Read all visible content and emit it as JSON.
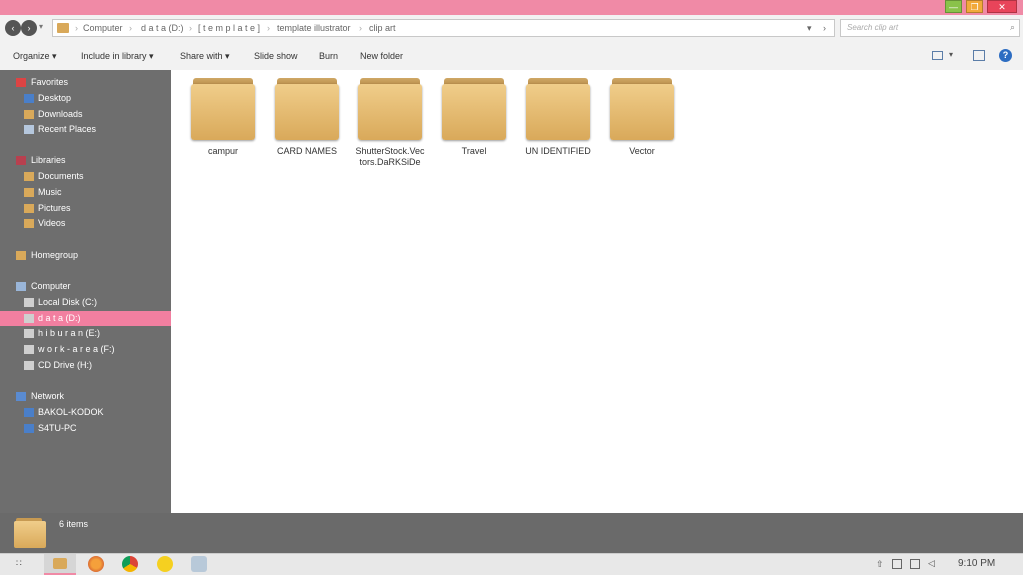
{
  "window": {
    "minimize_label": "—",
    "maximize_label": "❐",
    "close_label": "✕"
  },
  "address": {
    "crumbs": [
      "Computer",
      "d a t a (D:)",
      "[ t e m p l a t e ]",
      "template illustrator",
      "clip art"
    ],
    "dropdown_glyph": "▾",
    "refresh_glyph": "›"
  },
  "search": {
    "placeholder": "Search clip art"
  },
  "toolbar": {
    "organize": "Organize ▾",
    "include_library": "Include in library ▾",
    "share_with": "Share with ▾",
    "slide_show": "Slide show",
    "burn": "Burn",
    "new_folder": "New folder",
    "help_glyph": "?"
  },
  "sidebar": {
    "favorites": "Favorites",
    "desktop": "Desktop",
    "downloads": "Downloads",
    "recent_places": "Recent Places",
    "libraries": "Libraries",
    "documents": "Documents",
    "music": "Music",
    "pictures": "Pictures",
    "videos": "Videos",
    "homegroup": "Homegroup",
    "computer": "Computer",
    "local_disk": "Local Disk (C:)",
    "data_d": "d a t a (D:)",
    "hiburan": "h i b u r a n (E:)",
    "work_area": "w o r k - a r e a (F:)",
    "cd_drive": "CD Drive (H:)",
    "network": "Network",
    "bakol": "BAKOL-KODOK",
    "satu": "S4TU-PC"
  },
  "folders": [
    {
      "name": "campur"
    },
    {
      "name": "CARD NAMES"
    },
    {
      "name": "ShutterStock.Vectors.DaRKSiDe"
    },
    {
      "name": "Travel"
    },
    {
      "name": "UN IDENTIFIED"
    },
    {
      "name": "Vector"
    }
  ],
  "status": {
    "item_count": "6 items"
  },
  "taskbar": {
    "start_glyph": "∷",
    "clock": "9:10 PM"
  },
  "colors": {
    "accent": "#f08aa6",
    "selection": "#f27fa0",
    "folder": "#e0b56c"
  }
}
